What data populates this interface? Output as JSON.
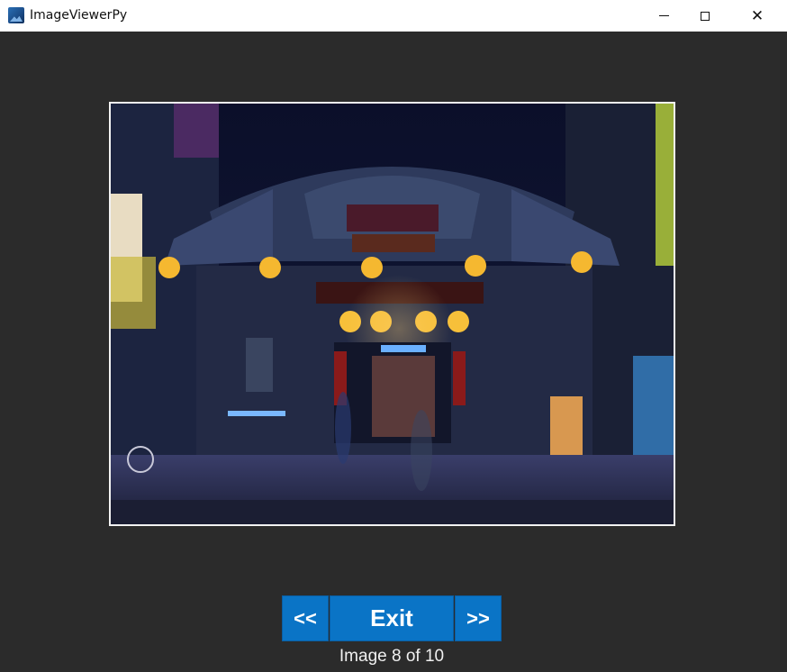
{
  "window": {
    "title": "ImageViewerPy",
    "app_icon": "image-viewer-icon"
  },
  "controls": {
    "minimize_icon": "minimize-icon",
    "maximize_icon": "maximize-icon",
    "close_icon": "close-icon",
    "close_glyph": "✕"
  },
  "photo": {
    "alt": "Night photo of an illuminated temple facade"
  },
  "buttons": {
    "prev_label": "<<",
    "exit_label": "Exit",
    "next_label": ">>"
  },
  "status": {
    "text": "Image 8 of 10"
  },
  "colors": {
    "background": "#2b2b2b",
    "button": "#0a74c6",
    "button_text": "#ffffff"
  }
}
